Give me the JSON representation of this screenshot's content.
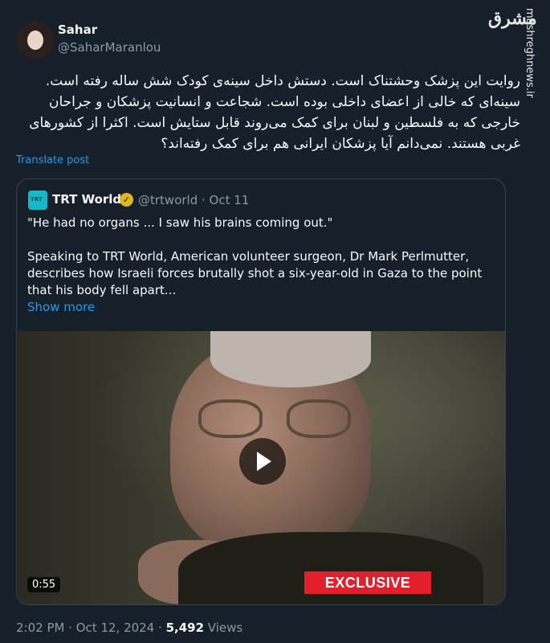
{
  "watermark": {
    "logo": "مشرق",
    "url": "mashreghnews.ir"
  },
  "author": {
    "name": "Sahar",
    "handle": "@SaharMaranlou"
  },
  "tweet": {
    "text": "روایت این پزشک وحشتناک است. دستش داخل سینه‌ی کودک شش ساله رفته است. سینه‌ای که خالی از اعضای داخلی بوده است. شجاعت و انسانیت پزشکان و جراحان خارجی که به فلسطین و لبنان برای کمک می‌روند قابل ستایش است. اکثرا از کشورهای غربی هستند. نمی‌دانم آیا پزشکان ایرانی هم برای کمک رفته‌اند؟",
    "translate_label": "Translate post"
  },
  "quote": {
    "name": "TRT World",
    "handle_date": "@trtworld · Oct 11",
    "quote_line": "\"He had no organs ... I saw his brains coming out.\"",
    "body": "Speaking to TRT World, American volunteer surgeon, Dr Mark Perlmutter, describes how Israeli forces brutally shot a six-year-old in Gaza to the point that his body fell apart...",
    "show_more": "Show more",
    "video": {
      "duration": "0:55",
      "banner": "EXCLUSIVE"
    }
  },
  "meta": {
    "time_date": "2:02 PM · Oct 12, 2024 · ",
    "views_count": "5,492",
    "views_label": " Views"
  },
  "colors": {
    "background": "#15202b",
    "link": "#1d9bf0",
    "muted": "#8b98a5",
    "exclusive": "#e41e2b",
    "verified": "#e2b719"
  }
}
